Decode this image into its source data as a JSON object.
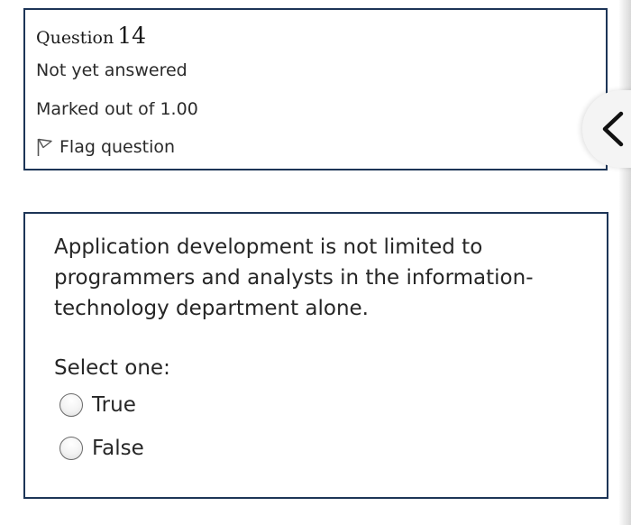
{
  "question_info": {
    "question_word": "Question",
    "question_number": "14",
    "status": "Not yet answered",
    "marks": "Marked out of 1.00",
    "flag_label": "Flag question"
  },
  "question": {
    "text": "Application development is not limited to programmers and analysts in the information-technology department alone.",
    "select_label": "Select one:",
    "options": [
      {
        "label": "True",
        "selected": false
      },
      {
        "label": "False",
        "selected": false
      }
    ]
  },
  "icons": {
    "flag": "flag-icon",
    "nav": "chevron-left-icon"
  },
  "colors": {
    "border": "#1d3557",
    "text": "#262626"
  }
}
